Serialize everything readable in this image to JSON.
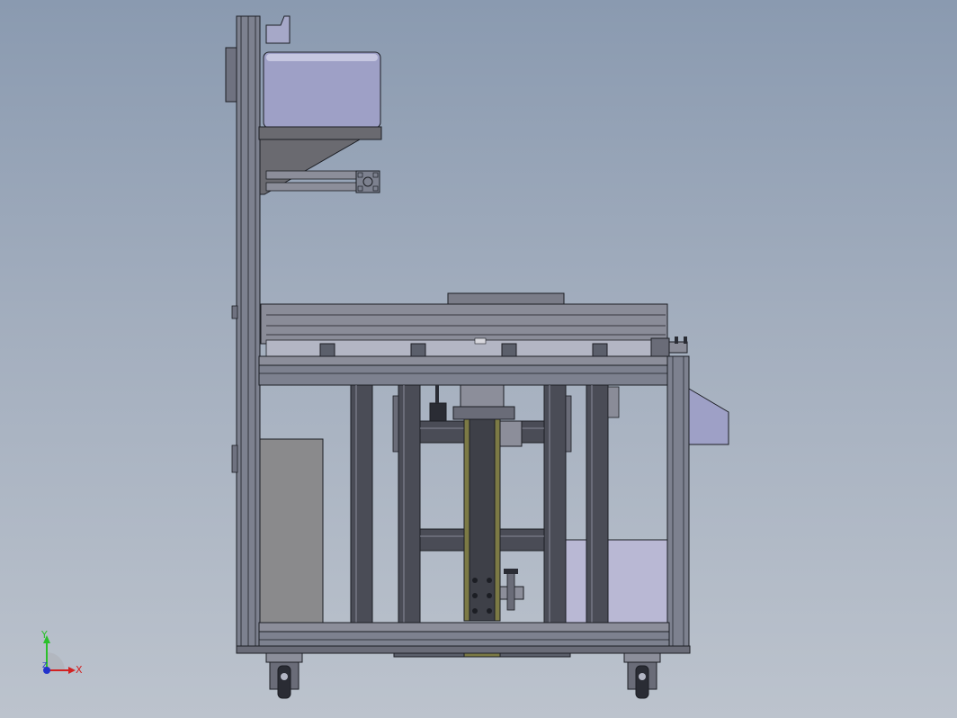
{
  "view": {
    "background_top": "#8a9ab0",
    "background_bottom": "#bcc3cd"
  },
  "colors": {
    "frame": "#7d818f",
    "frame_dark": "#5b5f6b",
    "line": "#1c1e24",
    "body_purple": "#9ea0c6",
    "shelf": "#6a6a70",
    "panel_gray": "#8a8a8c",
    "panel_light": "#b9b8d4",
    "bracket_olive": "#7c7a45",
    "post_dark": "#4a4c56"
  },
  "triad": {
    "y_label": "Y",
    "x_label": "X",
    "z_label": "Z",
    "y_color": "#2bc02b",
    "x_color": "#d22222",
    "z_color": "#2233cc"
  }
}
